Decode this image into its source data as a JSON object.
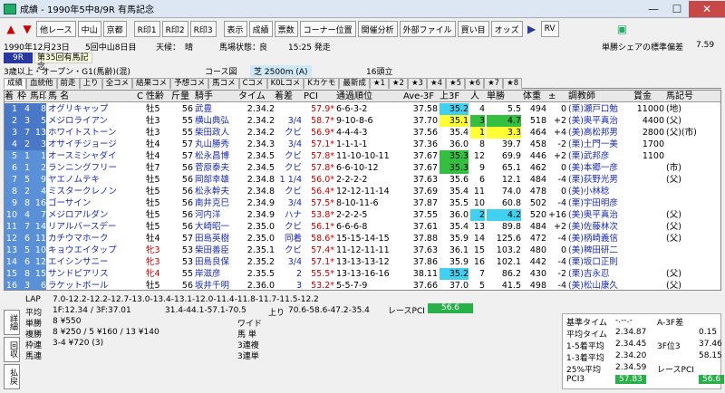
{
  "window": {
    "title": "成績 - 1990年5中8/9R 有馬記念",
    "minimize": "—",
    "maximize": "☐",
    "close": "✕"
  },
  "toolbar": {
    "prev_race": "他レース",
    "venue1": "中山",
    "venue2": "京都",
    "r1": "R印1",
    "r2": "R印2",
    "r3": "R印3",
    "display": "表示",
    "results": "成績",
    "odds_board": "票数",
    "corner": "コーナー位置",
    "dev_analysis": "開催分析",
    "ext_file": "外部ファイル",
    "buy": "買い目",
    "odds": "オッズ",
    "rv": "RV"
  },
  "race_info": {
    "date": "1990年12月23日",
    "meet": "5回中山8日目",
    "weather_label": "天候：",
    "weather": "晴",
    "track_label": "馬場状態：",
    "track": "良",
    "post_time": "15:25 発走",
    "share_label": "単勝シェアの標準偏差",
    "share_value": "7.59"
  },
  "race": {
    "number": "9R",
    "name": "第35回有馬記念",
    "class": "3歳以上・オープン・G1(馬齢)(混)",
    "course_label": "コース図",
    "course": "芝 2500m (A)",
    "heads": "16頭立"
  },
  "tabs": [
    "成績",
    "血統他",
    "前走",
    "上り",
    "全コメ",
    "結果コメ",
    "予想コメ",
    "馬コメ",
    "Cコメ",
    "K0Lコメ",
    "Kカケモ",
    "最新成",
    "★1",
    "★2",
    "★3",
    "★4",
    "★5",
    "★6",
    "★7",
    "★8"
  ],
  "columns": [
    "着",
    "枠",
    "馬印",
    "馬 名",
    "C",
    "性齢",
    "斤量",
    "騎手",
    "タイム",
    "着差",
    "PCI",
    "通過順位",
    "Ave-3F",
    "上3F",
    "人",
    "単勝",
    "体重",
    "±",
    "調教師",
    "賞金",
    "馬記号"
  ],
  "rows": [
    [
      "1",
      "4",
      "8",
      "オグリキャップ",
      "",
      "牡5",
      "56",
      "武豊",
      "2.34.2",
      "",
      "57.9*",
      "6-6-3-2",
      "37.58",
      "35.2",
      "4",
      "5.5",
      "494",
      "0",
      "(栗)瀬戸口勉",
      "11000",
      "(地)"
    ],
    [
      "2",
      "3",
      "5",
      "メジロライアン",
      "",
      "牡3",
      "55",
      "横山典弘",
      "2.34.2",
      "3/4",
      "58.7*",
      "9-10-8-6",
      "37.70",
      "35.1",
      "3",
      "4.7",
      "518",
      "+2",
      "(美)奥平真治",
      "4400",
      "(父)"
    ],
    [
      "3",
      "7",
      "13",
      "ホワイトストーン",
      "",
      "牡3",
      "55",
      "柴田政人",
      "2.34.2",
      "クビ",
      "56.9*",
      "4-4-4-3",
      "37.56",
      "35.4",
      "1",
      "3.3",
      "464",
      "+4",
      "(美)高松邦男",
      "2800",
      "(父)(市)"
    ],
    [
      "4",
      "2",
      "3",
      "オサイチジョージ",
      "",
      "牡4",
      "57",
      "丸山勝秀",
      "2.34.3",
      "3/4",
      "57.1*",
      "1-1-1-1",
      "37.36",
      "36.0",
      "8",
      "39.7",
      "458",
      "-2",
      "(栗)土門一美",
      "1700",
      ""
    ],
    [
      "5",
      "1",
      "1",
      "オースミシャダイ",
      "",
      "牡4",
      "57",
      "松永昌博",
      "2.34.5",
      "クビ",
      "57.8*",
      "11-10-10-11",
      "37.67",
      "35.3",
      "12",
      "69.9",
      "446",
      "+2",
      "(栗)武邦彦",
      "1100",
      ""
    ],
    [
      "6",
      "1",
      "2",
      "ランニングフリー",
      "",
      "牡7",
      "56",
      "菅原泰夫",
      "2.34.5",
      "クビ",
      "57.8*",
      "6-6-10-12",
      "37.67",
      "35.3",
      "9",
      "65.1",
      "462",
      "0",
      "(美)本郷一彦",
      "",
      "(市)"
    ],
    [
      "7",
      "5",
      "9",
      "ヤエノムテキ",
      "",
      "牡5",
      "56",
      "岡部幸雄",
      "2.34.8",
      "1 1/4",
      "56.0*",
      "2-2-2-2",
      "37.63",
      "35.6",
      "6",
      "12.1",
      "484",
      "-4",
      "(栗)荻野光男",
      "",
      "(父)"
    ],
    [
      "8",
      "2",
      "4",
      "ミスタークレノン",
      "",
      "牡5",
      "56",
      "松永幹夫",
      "2.34.8",
      "クビ",
      "56.4*",
      "12-12-11-14",
      "37.69",
      "35.4",
      "11",
      "74.0",
      "478",
      "0",
      "(美)小林稔",
      "",
      ""
    ],
    [
      "9",
      "8",
      "16",
      "ゴーサイン",
      "",
      "牡5",
      "56",
      "南井克巳",
      "2.34.9",
      "3/4",
      "57.5*",
      "8-10-11-6",
      "37.87",
      "35.5",
      "10",
      "60.8",
      "502",
      "-4",
      "(栗)宇田明彦",
      "",
      ""
    ],
    [
      "10",
      "4",
      "7",
      "メジロアルダン",
      "",
      "牡5",
      "56",
      "河内洋",
      "2.34.9",
      "ハナ",
      "53.8*",
      "2-2-2-5",
      "37.55",
      "36.0",
      "2",
      "4.2",
      "520",
      "+16",
      "(美)奥平真治",
      "",
      "(父)"
    ],
    [
      "11",
      "7",
      "14",
      "リアルバースデー",
      "",
      "牡5",
      "56",
      "大崎昭一",
      "2.35.0",
      "クビ",
      "56.1*",
      "6-6-6-8",
      "37.61",
      "35.4",
      "13",
      "89.8",
      "484",
      "+2",
      "(美)佐藤林次",
      "",
      "(父)"
    ],
    [
      "12",
      "6",
      "11",
      "カチウマホーク",
      "",
      "牡4",
      "57",
      "田島英樹",
      "2.35.0",
      "同着",
      "58.6*",
      "15-15-14-15",
      "37.88",
      "35.9",
      "14",
      "125.6",
      "472",
      "-4",
      "(美)柄崎義信",
      "",
      "(父)"
    ],
    [
      "13",
      "5",
      "10",
      "キョウエイタップ",
      "",
      "牝3",
      "53",
      "柴田善臣",
      "2.35.1",
      "クビ",
      "57.4*",
      "11-12-11-11",
      "37.63",
      "36.1",
      "15",
      "103.2",
      "480",
      "0",
      "(美)稗田研二",
      "",
      ""
    ],
    [
      "14",
      "6",
      "12",
      "エイシンサニー",
      "",
      "牝3",
      "53",
      "田島良保",
      "2.35.2",
      "3/4",
      "57.1*",
      "13-13-13-12",
      "37.86",
      "35.9",
      "16",
      "102.1",
      "442",
      "-4",
      "(栗)坂口正則",
      "",
      ""
    ],
    [
      "15",
      "8",
      "15",
      "サンドピアリス",
      "",
      "牝4",
      "55",
      "岸滋彦",
      "2.35.5",
      "2",
      "55.5*",
      "13-13-16-16",
      "38.11",
      "35.2",
      "7",
      "86.2",
      "430",
      "-2",
      "(栗)吉永忍",
      "",
      "(父)"
    ],
    [
      "16",
      "3",
      "6",
      "ラケットボール",
      "",
      "牡5",
      "56",
      "坂井千明",
      "2.36.0",
      "3",
      "53.2*",
      "5-5-7-9",
      "37.66",
      "37.0",
      "5",
      "41.5",
      "498",
      "-4",
      "(美)松山康久",
      "",
      "(父)"
    ]
  ],
  "bottom": {
    "side_buttons": [
      "詳細",
      "回収",
      "払戻"
    ],
    "lap_label": "LAP",
    "lap": "7.0-12.2-12.2-12.7-13.0-13.4-13.1-12.0-11.4-11.8-11.7-11.5-12.2",
    "avg_label": "平均",
    "avg": "1F:12.34 / 3F:37.01",
    "pace": "31.4-44.1-57.1-70.5",
    "agari_label": "上り",
    "agari": "70.6-58.6-47.2-35.4",
    "race_pci_label": "レースPCI",
    "race_pci": "56.6",
    "win_label": "単勝",
    "win": "8 ¥550",
    "wide_label": "ワイド",
    "place_label": "複勝",
    "place": "8 ¥250 / 5 ¥160 / 13 ¥140",
    "quinella_label": "馬 単",
    "bracket_label": "枠連",
    "bracket": "3-4 ¥720 (3)",
    "trio_label": "3連複",
    "exacta_label": "馬連",
    "trifecta_label": "3連単",
    "stats": [
      [
        "基準タイム",
        "-.--.-",
        "A-3F差",
        ""
      ],
      [
        "平均タイム",
        "2.34.87",
        "",
        "0.15"
      ],
      [
        "1-5着平均",
        "2.34.45",
        "3F位3",
        "37.46"
      ],
      [
        "1-3着平均",
        "2.34.20",
        "",
        "58.15"
      ],
      [
        "25%平均",
        "2.34.59",
        "レースPCI",
        ""
      ],
      [
        "PCI3",
        "57.83",
        "",
        "56.6"
      ]
    ]
  },
  "colors": {
    "pci_green": "#2ab04a",
    "highlight_yellow": "#ffff33",
    "highlight_cyan": "#40d0f0",
    "highlight_green": "#33c040",
    "row_blue": "#1a2ab0"
  }
}
